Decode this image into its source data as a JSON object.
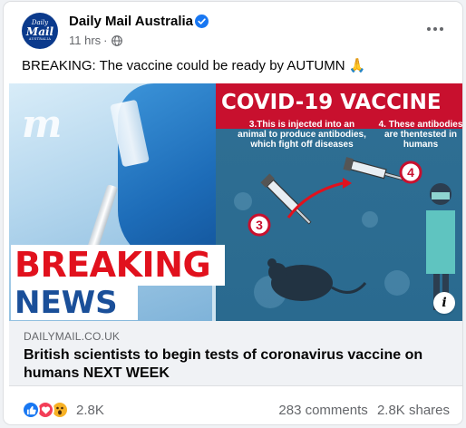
{
  "post": {
    "page_name": "Daily Mail Australia",
    "verified_icon": "verified-badge-icon",
    "timestamp": "11 hrs",
    "separator": "·",
    "privacy_icon": "globe-icon",
    "text": "BREAKING: The vaccine could be ready by AUTUMN 🙏",
    "avatar": {
      "line1": "Daily",
      "line2": "Mail",
      "line3": "AUSTRALIA"
    }
  },
  "image": {
    "logo_letter": "m",
    "breaking_label": "BREAKING",
    "news_label": "NEWS",
    "banner_title": "COVID-19 VACCINE",
    "step3_text": "3.This is injected into an animal to produce antibodies, which fight off diseases",
    "step4_text": "4. These antibodies are thentested in humans",
    "step3_number": "3",
    "step4_number": "4",
    "info_label": "i"
  },
  "link": {
    "domain": "DAILYMAIL.CO.UK",
    "headline": "British scientists to begin tests of coronavirus vaccine on humans NEXT WEEK"
  },
  "footer": {
    "reaction_icons": [
      "like-icon",
      "love-icon",
      "wow-icon"
    ],
    "reaction_count": "2.8K",
    "comments": "283 comments",
    "shares": "2.8K shares"
  },
  "colors": {
    "brand_blue": "#1877f2",
    "breaking_red": "#e1111d",
    "news_blue": "#1a4f99",
    "banner_red": "#c8102e"
  }
}
